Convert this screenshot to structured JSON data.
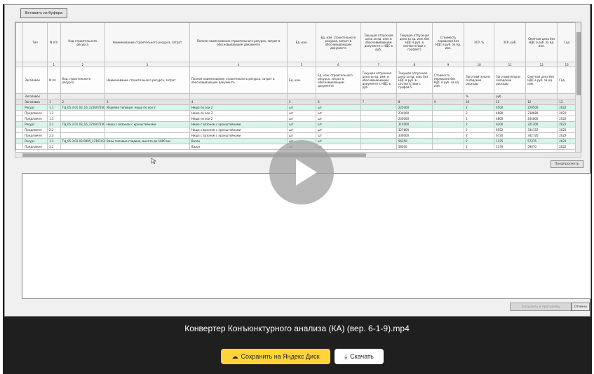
{
  "toolbar": {
    "paste_label": "Вставить из буфера"
  },
  "grid": {
    "headers": [
      "",
      "Тип",
      "N п/п",
      "Код строительного ресурса",
      "Наименование строительного ресурса, затрат",
      "Полное наименование строительного ресурса, затрат в обосновывающем документе",
      "Ед. изм.",
      "Ед. изм. строительного ресурса, затрат в обосновывающем документе",
      "Текущая отпускная цена за ед. изм. в обосновывающем документе с НДС в руб.",
      "Текущая отпускная цена за ед. изм. без НДС в руб. в соответствии с графой 5",
      "Стоимость перевозки без НДС в руб. за ед. изм.",
      "ЗСР, %",
      "ЗСР, руб.",
      "Сметная цена без НДС в руб. за ед. изм.",
      "Год"
    ],
    "col_numbers": [
      "",
      "",
      "1",
      "2",
      "3",
      "4",
      "5",
      "6",
      "7",
      "8",
      "9",
      "10",
      "11",
      "12",
      "13"
    ],
    "subheaders": [
      "",
      "Заголовок",
      "N пп",
      "Код строительного ресурса",
      "Наименование строительного ресурса, затрат",
      "Полное наименование строительного ресурса, затрат в обосновывающем документе",
      "Ед. изм.",
      "Ед. изм. строительного ресурса, затрат в обосновывающем документе",
      "Текущая отпускная цена за ед. изм. в обосновывающем документе с НДС в руб.",
      "Текущая отпускная цена за ед. изм. без НДС в руб. в соответствии с графой 5",
      "Стоимость перевозки без НДС в руб. за ед. изм.",
      "Заготовительно-складские расходы",
      "Заготовительно-складские расходы",
      "Сметная цена без НДС в руб. за ед. изм.",
      "Год"
    ],
    "units_row": [
      "",
      "Заголовок",
      "",
      "",
      "",
      "",
      "",
      "",
      "",
      "",
      "",
      "%",
      "руб.",
      "",
      ""
    ],
    "colnum_row": [
      "",
      "Заголовок",
      "1",
      "2",
      "3",
      "4",
      "5",
      "6",
      "7",
      "8",
      "9",
      "10",
      "11",
      "12",
      "13"
    ],
    "rows": [
      {
        "kind": "res",
        "cells": [
          "",
          "Ресурс",
          "1.1",
          "ТЦ_05.3.01.03_16_1216071008",
          "Изделия типовые: ниша по оси 2",
          "Ниша по оси 2",
          "шт",
          "шт",
          "",
          "225000",
          "",
          "2",
          "4500",
          "229500",
          "2022"
        ]
      },
      {
        "kind": "prop",
        "cells": [
          "",
          "Предложен",
          "1.2",
          "",
          "",
          "Ниша по оси 2",
          "шт",
          "шт",
          "",
          "234000",
          "",
          "2",
          "4680",
          "238680",
          "2022"
        ]
      },
      {
        "kind": "prop",
        "cells": [
          "",
          "Предложен",
          "1.3",
          "",
          "",
          "Ниша по оси 2",
          "шт",
          "шт",
          "",
          "240000",
          "",
          "2",
          "4800",
          "244800",
          "2022"
        ]
      },
      {
        "kind": "res",
        "cells": [
          "",
          "Ресурс",
          "2.1",
          "ТЦ_05.3.01.03_16_1216071008",
          "Ниша с вазоном с кронштейнами",
          "Ниша с вазоном с кронштейнами",
          "шт",
          "шт",
          "",
          "315000",
          "",
          "2",
          "6300",
          "321300",
          "2022"
        ]
      },
      {
        "kind": "prop",
        "cells": [
          "",
          "Предложен",
          "2.2",
          "",
          "",
          "Ниша с вазоном с кронштейнами",
          "шт",
          "шт",
          "",
          "327600",
          "",
          "2",
          "6552",
          "334152",
          "2022"
        ]
      },
      {
        "kind": "prop",
        "cells": [
          "",
          "Предложен",
          "2.3",
          "",
          "",
          "Ниша с вазоном с кронштейнами",
          "шт",
          "шт",
          "",
          "336000",
          "",
          "2",
          "6720",
          "342720",
          "2022"
        ]
      },
      {
        "kind": "res",
        "cells": [
          "",
          "Ресурс",
          "3.1",
          "ТЦ_05.3.01.03-0005_1216103",
          "Вазы типовые гладкие, высота до 1000 мм",
          "Вазон",
          "шт",
          "шт",
          "",
          "56250",
          "",
          "2",
          "1125",
          "57375",
          "2022"
        ]
      },
      {
        "kind": "prop",
        "cells": [
          "",
          "Предложен",
          "3.2",
          "",
          "",
          "Вазон",
          "шт",
          "шт",
          "",
          "58500",
          "",
          "2",
          "1170",
          "59670",
          "2022"
        ]
      }
    ]
  },
  "buttons": {
    "preview": "Предпросмотр",
    "load": "Загрузить в программу",
    "cancel": "Отмена"
  },
  "video": {
    "title": "Конвертер Конъюнктурного анализа (КА) (вер. 6-1-9).mp4",
    "save_label": "Сохранить на Яндекс Диск",
    "download_label": "Скачать"
  }
}
